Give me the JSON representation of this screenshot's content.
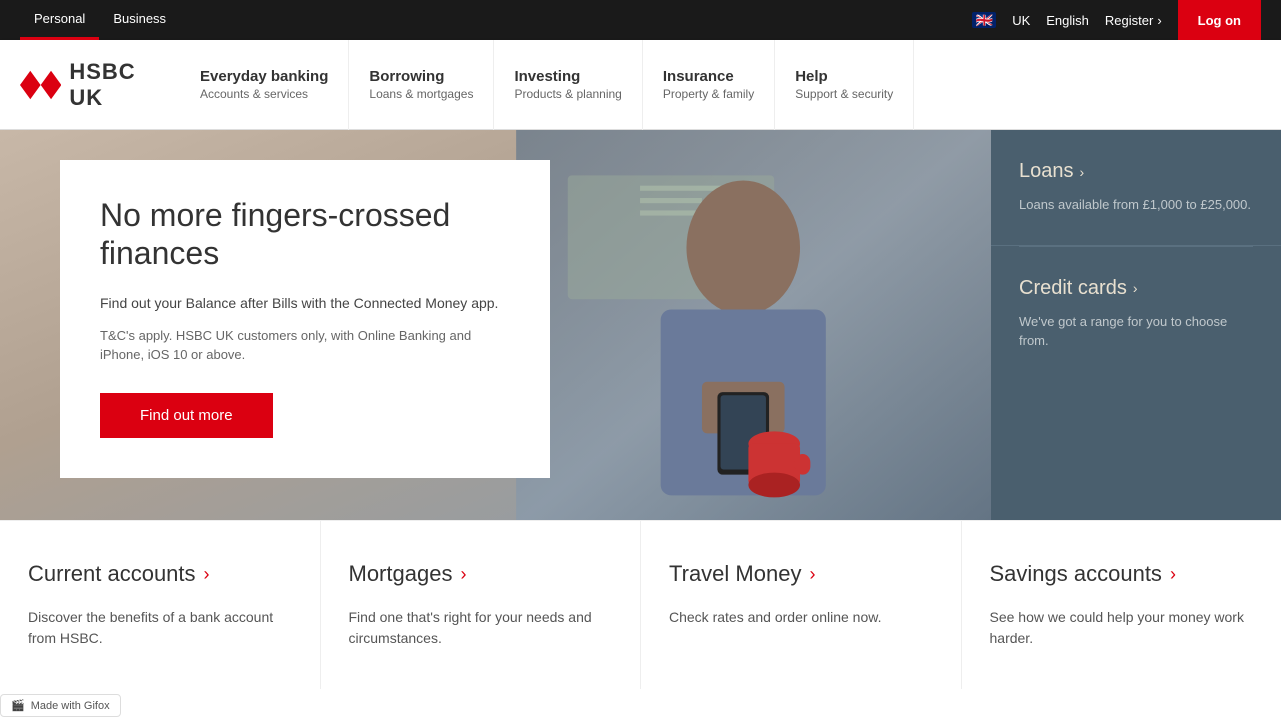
{
  "topbar": {
    "personal_label": "Personal",
    "business_label": "Business",
    "uk_label": "UK",
    "english_label": "English",
    "register_label": "Register",
    "logon_label": "Log on"
  },
  "nav": {
    "logo_text": "HSBC UK",
    "items": [
      {
        "main": "Everyday banking",
        "sub": "Accounts & services"
      },
      {
        "main": "Borrowing",
        "sub": "Loans & mortgages"
      },
      {
        "main": "Investing",
        "sub": "Products & planning"
      },
      {
        "main": "Insurance",
        "sub": "Property & family"
      },
      {
        "main": "Help",
        "sub": "Support & security"
      }
    ]
  },
  "hero": {
    "title": "No more fingers-crossed finances",
    "desc": "Find out your Balance after Bills with the Connected Money app.",
    "desc2": "T&C's apply. HSBC UK customers only, with Online Banking and iPhone, iOS 10 or above.",
    "cta": "Find out more"
  },
  "sidebar": {
    "loans_title": "Loans",
    "loans_desc": "Loans available from £1,000 to £25,000.",
    "credit_title": "Credit cards",
    "credit_desc": "We've got a range for you to choose from."
  },
  "bottom_cards": [
    {
      "title": "Current accounts",
      "desc": "Discover the benefits of a bank account from HSBC."
    },
    {
      "title": "Mortgages",
      "desc": "Find one that's right for your needs and circumstances."
    },
    {
      "title": "Travel Money",
      "desc": "Check rates and order online now."
    },
    {
      "title": "Savings accounts",
      "desc": "See how we could help your money work harder."
    }
  ],
  "gifox": {
    "label": "Made with Gifox"
  }
}
